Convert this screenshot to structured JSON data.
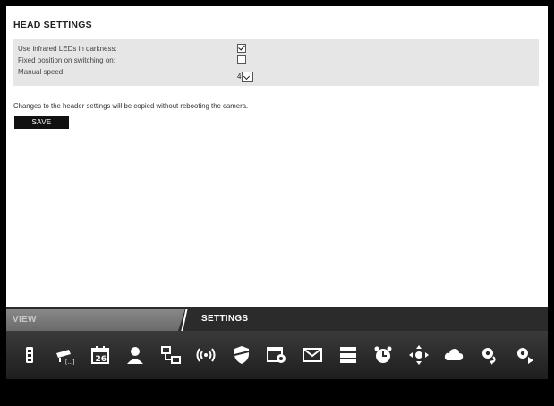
{
  "page": {
    "title": "HEAD SETTINGS"
  },
  "settings": [
    {
      "label": "Use infrared LEDs in darkness:",
      "type": "checkbox",
      "checked": true
    },
    {
      "label": "Fixed position on switching on:",
      "type": "checkbox",
      "checked": false
    },
    {
      "label": "Manual speed:",
      "type": "select",
      "value": "4"
    }
  ],
  "note": "Changes to the header settings will be copied without rebooting the camera.",
  "save_label": "SAVE",
  "tabs": {
    "view": "VIEW",
    "settings": "SETTINGS"
  },
  "toolbar_icons": [
    "camera-io-icon",
    "camera-settings-icon",
    "calendar-icon",
    "user-icon",
    "network-icon",
    "wireless-icon",
    "security-shield-icon",
    "web-settings-icon",
    "email-icon",
    "storage-icon",
    "alarm-clock-icon",
    "ptz-control-icon",
    "cloud-icon",
    "system-update-icon",
    "advanced-settings-icon"
  ],
  "calendar_day": "26",
  "colors": {
    "toolbar_bg": "#2b2b2b",
    "tab_view_bg": "#7a7a7a",
    "settings_box_bg": "#e6e6e6",
    "save_bg": "#111111"
  }
}
